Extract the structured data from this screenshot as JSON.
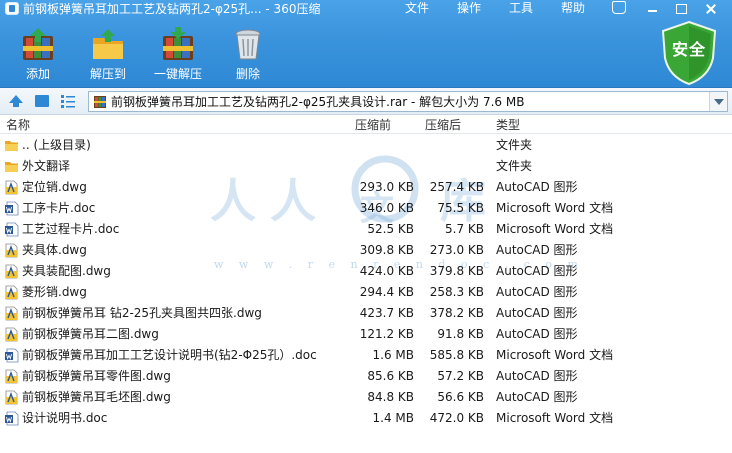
{
  "window": {
    "title": "前钢板弹簧吊耳加工工艺及钻两孔2-φ25孔... - 360压缩"
  },
  "menu": {
    "items": [
      {
        "label": "文件"
      },
      {
        "label": "操作"
      },
      {
        "label": "工具"
      },
      {
        "label": "帮助"
      }
    ]
  },
  "toolbar": {
    "buttons": [
      {
        "label": "添加",
        "icon": "add-books-icon"
      },
      {
        "label": "解压到",
        "icon": "extract-folder-icon"
      },
      {
        "label": "一键解压",
        "icon": "one-click-extract-icon"
      },
      {
        "label": "删除",
        "icon": "trash-icon"
      }
    ],
    "shield_label": "安全"
  },
  "address": {
    "path": "前钢板弹簧吊耳加工工艺及钻两孔2-φ25孔夹具设计.rar - 解包大小为 7.6 MB"
  },
  "columns": {
    "name": "名称",
    "size": "压缩前",
    "packed": "压缩后",
    "type": "类型"
  },
  "files": [
    {
      "name": ".. (上级目录)",
      "size": "",
      "packed": "",
      "type": "文件夹",
      "icon": "folder"
    },
    {
      "name": "外文翻译",
      "size": "",
      "packed": "",
      "type": "文件夹",
      "icon": "folder"
    },
    {
      "name": "定位销.dwg",
      "size": "293.0 KB",
      "packed": "257.4 KB",
      "type": "AutoCAD 图形",
      "icon": "dwg"
    },
    {
      "name": "工序卡片.doc",
      "size": "346.0 KB",
      "packed": "75.5 KB",
      "type": "Microsoft Word 文档",
      "icon": "doc"
    },
    {
      "name": "工艺过程卡片.doc",
      "size": "52.5 KB",
      "packed": "5.7 KB",
      "type": "Microsoft Word 文档",
      "icon": "doc"
    },
    {
      "name": "夹具体.dwg",
      "size": "309.8 KB",
      "packed": "273.0 KB",
      "type": "AutoCAD 图形",
      "icon": "dwg"
    },
    {
      "name": "夹具装配图.dwg",
      "size": "424.0 KB",
      "packed": "379.8 KB",
      "type": "AutoCAD 图形",
      "icon": "dwg"
    },
    {
      "name": "菱形销.dwg",
      "size": "294.4 KB",
      "packed": "258.3 KB",
      "type": "AutoCAD 图形",
      "icon": "dwg"
    },
    {
      "name": "前钢板弹簧吊耳 钻2-25孔夹具图共四张.dwg",
      "size": "423.7 KB",
      "packed": "378.2 KB",
      "type": "AutoCAD 图形",
      "icon": "dwg"
    },
    {
      "name": "前钢板弹簧吊耳二图.dwg",
      "size": "121.2 KB",
      "packed": "91.8 KB",
      "type": "AutoCAD 图形",
      "icon": "dwg"
    },
    {
      "name": "前钢板弹簧吊耳加工工艺设计说明书(钻2-Φ25孔）.doc",
      "size": "1.6 MB",
      "packed": "585.8 KB",
      "type": "Microsoft Word 文档",
      "icon": "doc"
    },
    {
      "name": "前钢板弹簧吊耳零件图.dwg",
      "size": "85.6 KB",
      "packed": "57.2 KB",
      "type": "AutoCAD 图形",
      "icon": "dwg"
    },
    {
      "name": "前钢板弹簧吊耳毛坯图.dwg",
      "size": "84.8 KB",
      "packed": "56.6 KB",
      "type": "AutoCAD 图形",
      "icon": "dwg"
    },
    {
      "name": "设计说明书.doc",
      "size": "1.4 MB",
      "packed": "472.0 KB",
      "type": "Microsoft Word 文档",
      "icon": "doc"
    }
  ],
  "watermark": {
    "chars": [
      "人",
      "人",
      "文",
      "库"
    ],
    "url": "w w w . r e n r e n d o c . c o m"
  },
  "colors": {
    "chrome_blue": "#3a93dc",
    "shield_green": "#3aa635",
    "folder_yellow": "#f2c23a",
    "dwg_yellow": "#f4c430",
    "doc_blue": "#2b5797"
  }
}
